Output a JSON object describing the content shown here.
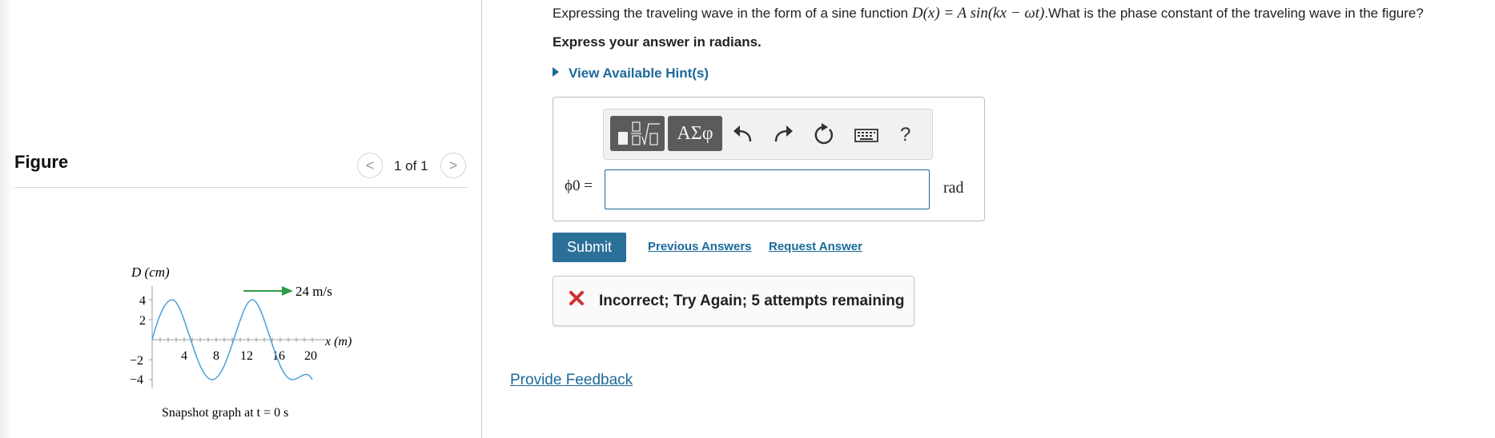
{
  "figure": {
    "title": "Figure",
    "pager": "1 of 1",
    "prev_glyph": "<",
    "next_glyph": ">",
    "graph": {
      "y_axis_label": "D (cm)",
      "x_axis_label": "x (m)",
      "velocity_label": "24 m/s",
      "caption": "Snapshot graph at t = 0 s",
      "y_ticks": [
        "4",
        "2",
        "−2",
        "−4"
      ],
      "x_ticks": [
        "4",
        "8",
        "12",
        "16",
        "20"
      ],
      "arrow_color": "#2e9a44",
      "wave_color": "#4a9fd8"
    }
  },
  "question": {
    "prefix": "Expressing the traveling wave in the form of a sine function ",
    "math": "D(x) = A sin(kx − ωt)",
    "suffix": ".What is the phase constant of the traveling wave in the figure?",
    "instruction": "Express your answer in radians.",
    "hint_label": "View Available Hint(s)"
  },
  "answer": {
    "toolbar": {
      "templates_icon": "templates-icon",
      "greek_label": "ΑΣφ",
      "undo_icon": "undo-icon",
      "redo_icon": "redo-icon",
      "reset_icon": "reset-icon",
      "keyboard_icon": "keyboard-icon",
      "help_label": "?"
    },
    "variable_label": "ϕ0 =",
    "input_value": "",
    "unit": "rad"
  },
  "actions": {
    "submit_label": "Submit",
    "previous_answers": "Previous Answers",
    "request_answer": "Request Answer"
  },
  "feedback": {
    "message": "Incorrect; Try Again; 5 attempts remaining",
    "icon": "error-x-icon",
    "icon_color": "#d32f2f"
  },
  "footer": {
    "provide_feedback": "Provide Feedback"
  },
  "colors": {
    "link": "#1b6a9a",
    "submit_bg": "#2b7099",
    "toolbar_button": "#5b5b5b"
  }
}
